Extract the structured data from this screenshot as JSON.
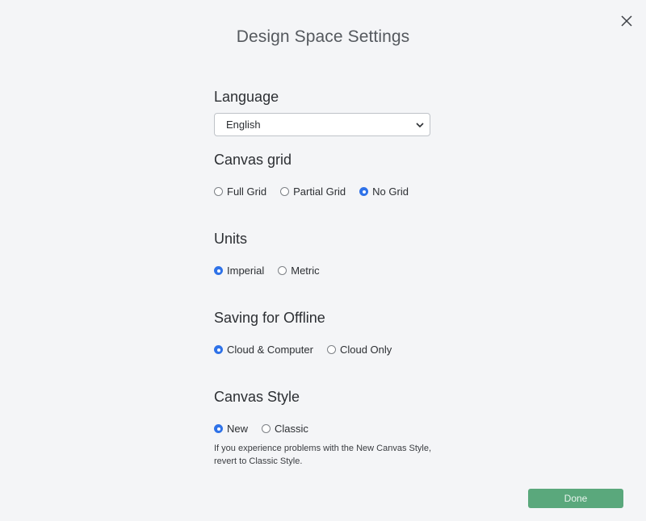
{
  "dialog": {
    "title": "Design Space Settings",
    "done_label": "Done"
  },
  "language": {
    "title": "Language",
    "selected": "English"
  },
  "canvas_grid": {
    "title": "Canvas grid",
    "options": [
      "Full Grid",
      "Partial Grid",
      "No Grid"
    ],
    "selected": "No Grid"
  },
  "units": {
    "title": "Units",
    "options": [
      "Imperial",
      "Metric"
    ],
    "selected": "Imperial"
  },
  "offline": {
    "title": "Saving for Offline",
    "options": [
      "Cloud & Computer",
      "Cloud Only"
    ],
    "selected": "Cloud & Computer"
  },
  "canvas_style": {
    "title": "Canvas Style",
    "options": [
      "New",
      "Classic"
    ],
    "selected": "New",
    "help": "If you experience problems with the New Canvas Style, revert to Classic Style."
  },
  "colors": {
    "accent": "#2f72e8",
    "done_button": "#5aa87c",
    "background": "#f4f5f7"
  }
}
